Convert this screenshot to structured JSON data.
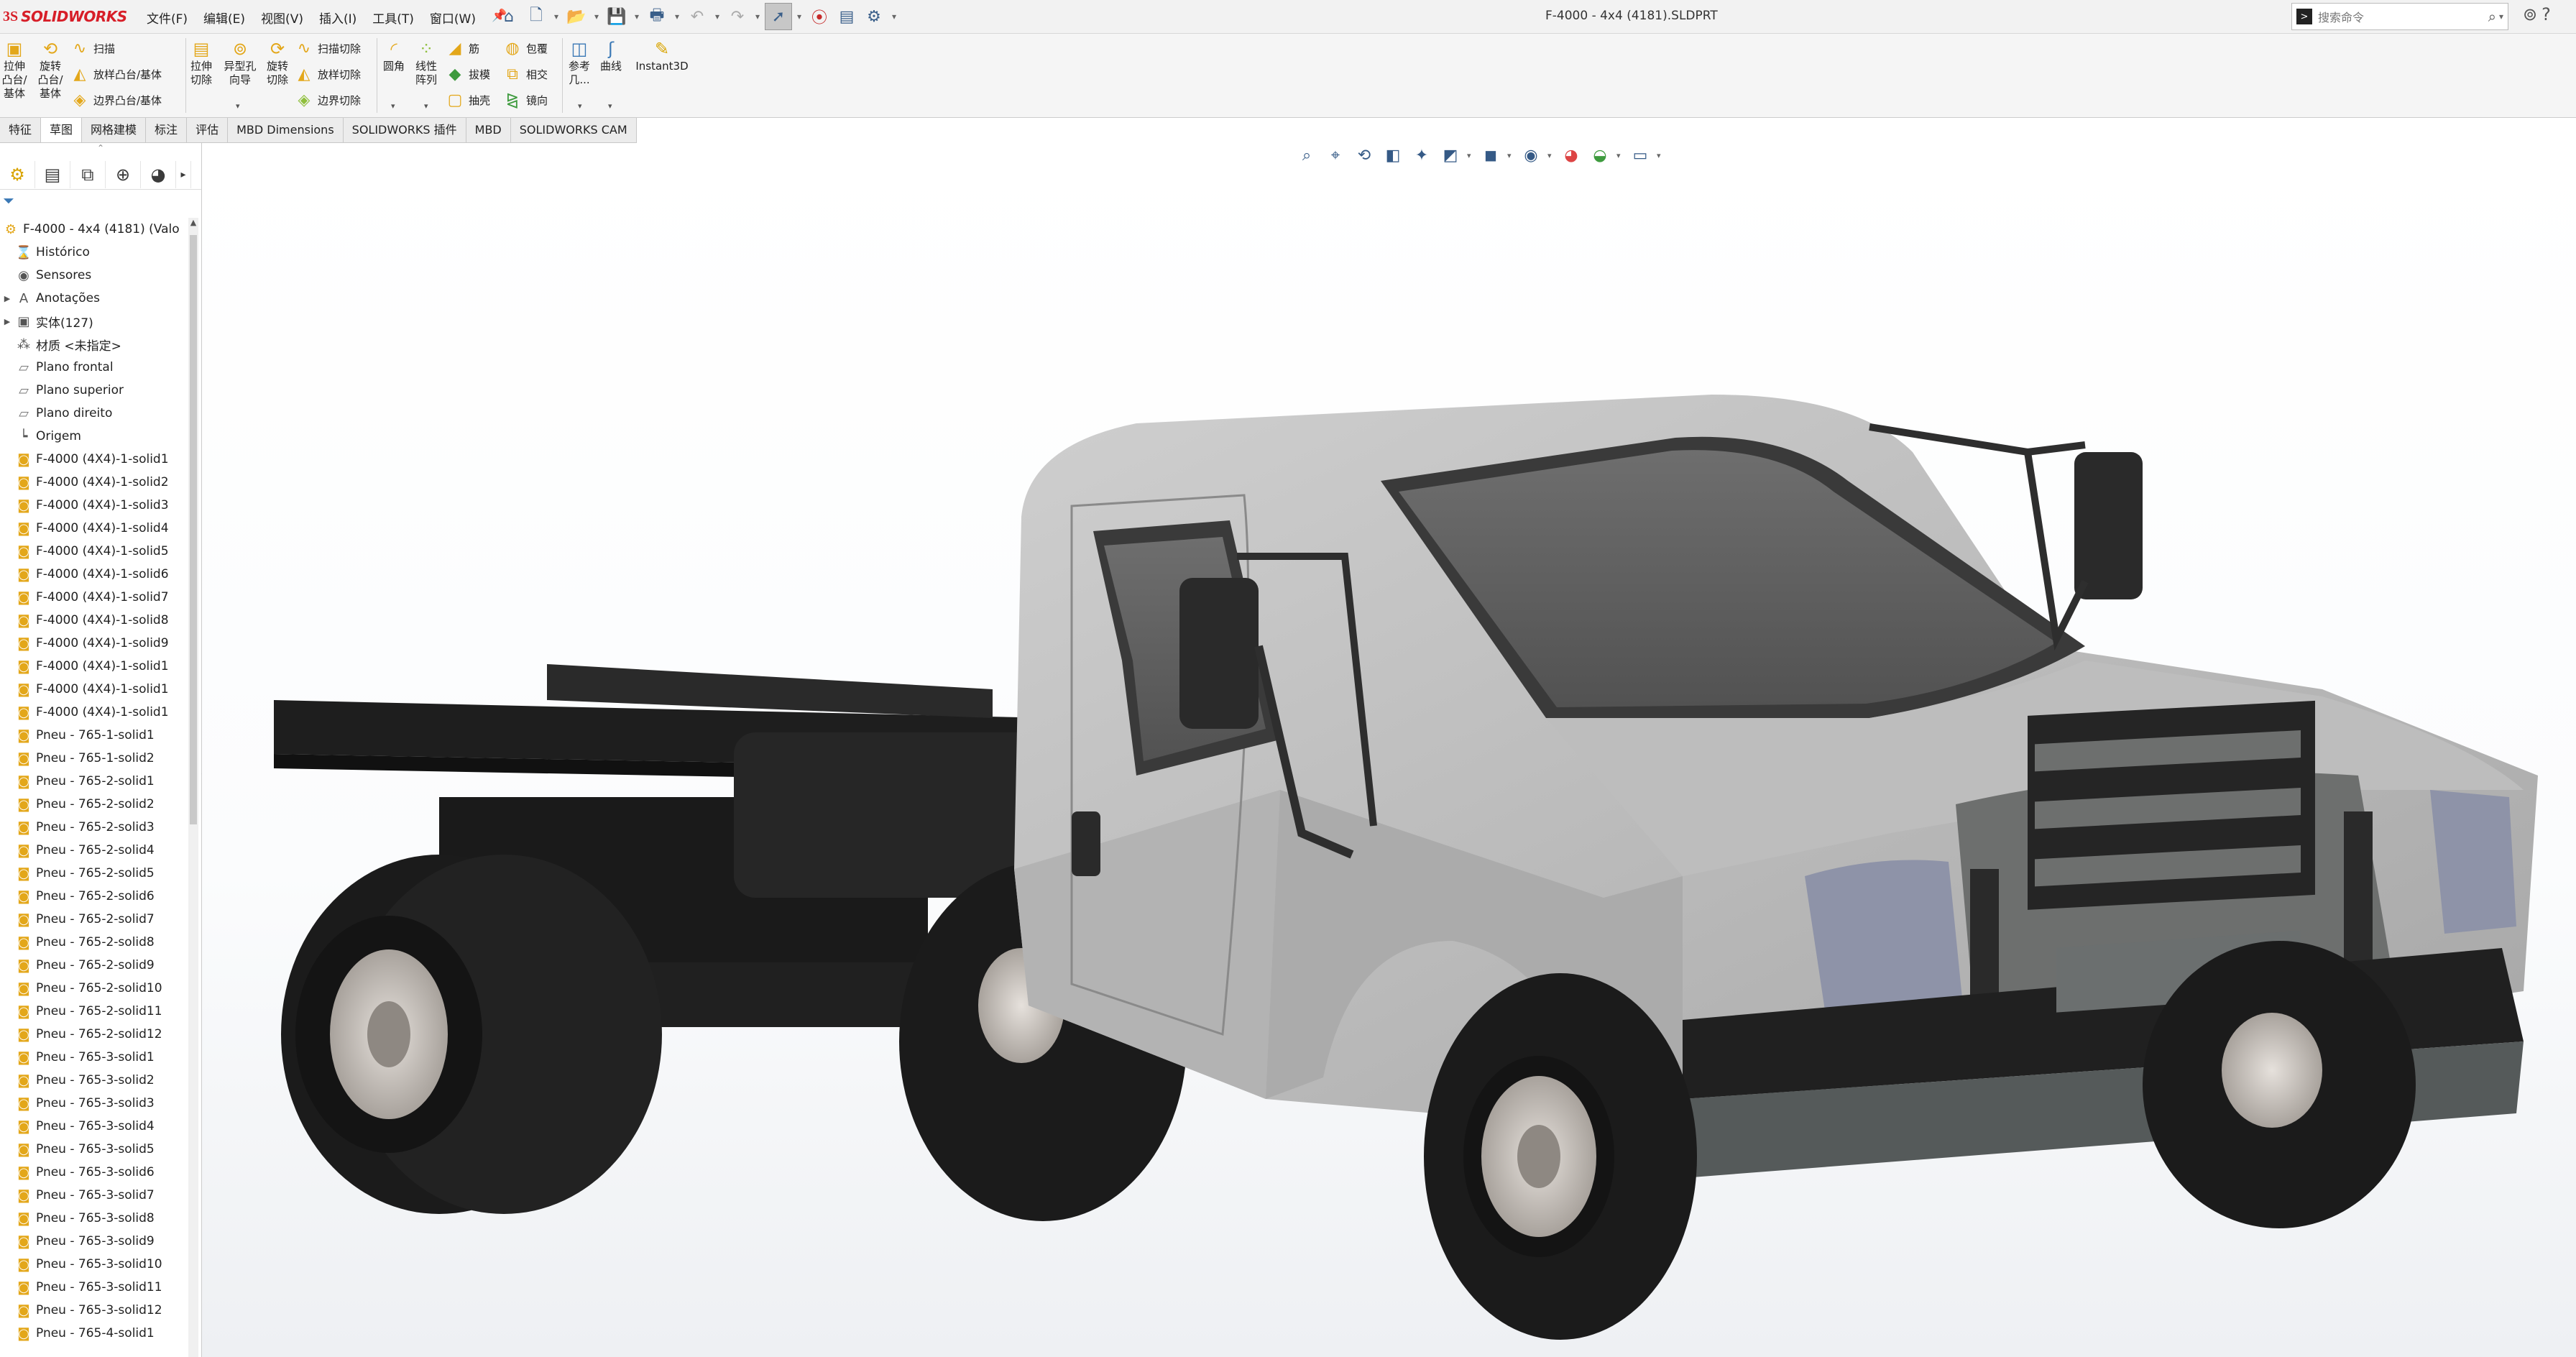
{
  "app": {
    "logo_ds": "3S",
    "logo_name": "SOLIDWORKS",
    "document_title": "F-4000 - 4x4 (4181).SLDPRT"
  },
  "menu": [
    "文件(F)",
    "编辑(E)",
    "视图(V)",
    "插入(I)",
    "工具(T)",
    "窗口(W)"
  ],
  "search": {
    "placeholder": "搜索命令"
  },
  "ribbon": {
    "extrude_boss": [
      "拉伸",
      "凸台/",
      "基体"
    ],
    "revolve_boss": [
      "旋转",
      "凸台/",
      "基体"
    ],
    "sweep": "扫描",
    "loft_boss": "放样凸台/基体",
    "boundary_boss": "边界凸台/基体",
    "extrude_cut": [
      "拉伸",
      "切除"
    ],
    "hole_wizard": [
      "异型孔",
      "向导"
    ],
    "revolve_cut": [
      "旋转",
      "切除"
    ],
    "sweep_cut": "扫描切除",
    "loft_cut": "放样切除",
    "boundary_cut": "边界切除",
    "fillet": "圆角",
    "linear_pattern": [
      "线性",
      "阵列"
    ],
    "rib": "筋",
    "draft": "拔模",
    "shell": "抽壳",
    "wrap": "包覆",
    "intersect": "相交",
    "mirror": "镜向",
    "reference_geometry": [
      "参考",
      "几..."
    ],
    "curves": "曲线",
    "instant3d": "Instant3D"
  },
  "tabs": [
    "特征",
    "草图",
    "网格建模",
    "标注",
    "评估",
    "MBD Dimensions",
    "SOLIDWORKS 插件",
    "MBD",
    "SOLIDWORKS CAM"
  ],
  "feature_tree": {
    "root": "F-4000 - 4x4 (4181) (Valo",
    "items": [
      {
        "label": "Histórico",
        "icon": "history-icon"
      },
      {
        "label": "Sensores",
        "icon": "sensor-icon"
      },
      {
        "label": "Anotações",
        "icon": "annotation-icon"
      },
      {
        "label": "实体(127)",
        "icon": "solid-bodies-icon"
      },
      {
        "label": "材质 <未指定>",
        "icon": "material-icon"
      },
      {
        "label": "Plano frontal",
        "icon": "plane-icon"
      },
      {
        "label": "Plano superior",
        "icon": "plane-icon"
      },
      {
        "label": "Plano direito",
        "icon": "plane-icon"
      },
      {
        "label": "Origem",
        "icon": "origin-icon"
      },
      {
        "label": "F-4000 (4X4)-1-solid1",
        "icon": "body-icon"
      },
      {
        "label": "F-4000 (4X4)-1-solid2",
        "icon": "body-icon"
      },
      {
        "label": "F-4000 (4X4)-1-solid3",
        "icon": "body-icon"
      },
      {
        "label": "F-4000 (4X4)-1-solid4",
        "icon": "body-icon"
      },
      {
        "label": "F-4000 (4X4)-1-solid5",
        "icon": "body-icon"
      },
      {
        "label": "F-4000 (4X4)-1-solid6",
        "icon": "body-icon"
      },
      {
        "label": "F-4000 (4X4)-1-solid7",
        "icon": "body-icon"
      },
      {
        "label": "F-4000 (4X4)-1-solid8",
        "icon": "body-icon"
      },
      {
        "label": "F-4000 (4X4)-1-solid9",
        "icon": "body-icon"
      },
      {
        "label": "F-4000 (4X4)-1-solid1",
        "icon": "body-icon"
      },
      {
        "label": "F-4000 (4X4)-1-solid1",
        "icon": "body-icon"
      },
      {
        "label": "F-4000 (4X4)-1-solid1",
        "icon": "body-icon"
      },
      {
        "label": "Pneu - 765-1-solid1",
        "icon": "body-icon"
      },
      {
        "label": "Pneu - 765-1-solid2",
        "icon": "body-icon"
      },
      {
        "label": "Pneu - 765-2-solid1",
        "icon": "body-icon"
      },
      {
        "label": "Pneu - 765-2-solid2",
        "icon": "body-icon"
      },
      {
        "label": "Pneu - 765-2-solid3",
        "icon": "body-icon"
      },
      {
        "label": "Pneu - 765-2-solid4",
        "icon": "body-icon"
      },
      {
        "label": "Pneu - 765-2-solid5",
        "icon": "body-icon"
      },
      {
        "label": "Pneu - 765-2-solid6",
        "icon": "body-icon"
      },
      {
        "label": "Pneu - 765-2-solid7",
        "icon": "body-icon"
      },
      {
        "label": "Pneu - 765-2-solid8",
        "icon": "body-icon"
      },
      {
        "label": "Pneu - 765-2-solid9",
        "icon": "body-icon"
      },
      {
        "label": "Pneu - 765-2-solid10",
        "icon": "body-icon"
      },
      {
        "label": "Pneu - 765-2-solid11",
        "icon": "body-icon"
      },
      {
        "label": "Pneu - 765-2-solid12",
        "icon": "body-icon"
      },
      {
        "label": "Pneu - 765-3-solid1",
        "icon": "body-icon"
      },
      {
        "label": "Pneu - 765-3-solid2",
        "icon": "body-icon"
      },
      {
        "label": "Pneu - 765-3-solid3",
        "icon": "body-icon"
      },
      {
        "label": "Pneu - 765-3-solid4",
        "icon": "body-icon"
      },
      {
        "label": "Pneu - 765-3-solid5",
        "icon": "body-icon"
      },
      {
        "label": "Pneu - 765-3-solid6",
        "icon": "body-icon"
      },
      {
        "label": "Pneu - 765-3-solid7",
        "icon": "body-icon"
      },
      {
        "label": "Pneu - 765-3-solid8",
        "icon": "body-icon"
      },
      {
        "label": "Pneu - 765-3-solid9",
        "icon": "body-icon"
      },
      {
        "label": "Pneu - 765-3-solid10",
        "icon": "body-icon"
      },
      {
        "label": "Pneu - 765-3-solid11",
        "icon": "body-icon"
      },
      {
        "label": "Pneu - 765-3-solid12",
        "icon": "body-icon"
      },
      {
        "label": "Pneu - 765-4-solid1",
        "icon": "body-icon"
      }
    ]
  },
  "colors": {
    "brand_red": "#d71e28",
    "body_icon": "#e3a71a",
    "cab_grey": "#b8b8b8",
    "chassis_black": "#1e1e1e",
    "headlight": "#8e93a8"
  }
}
